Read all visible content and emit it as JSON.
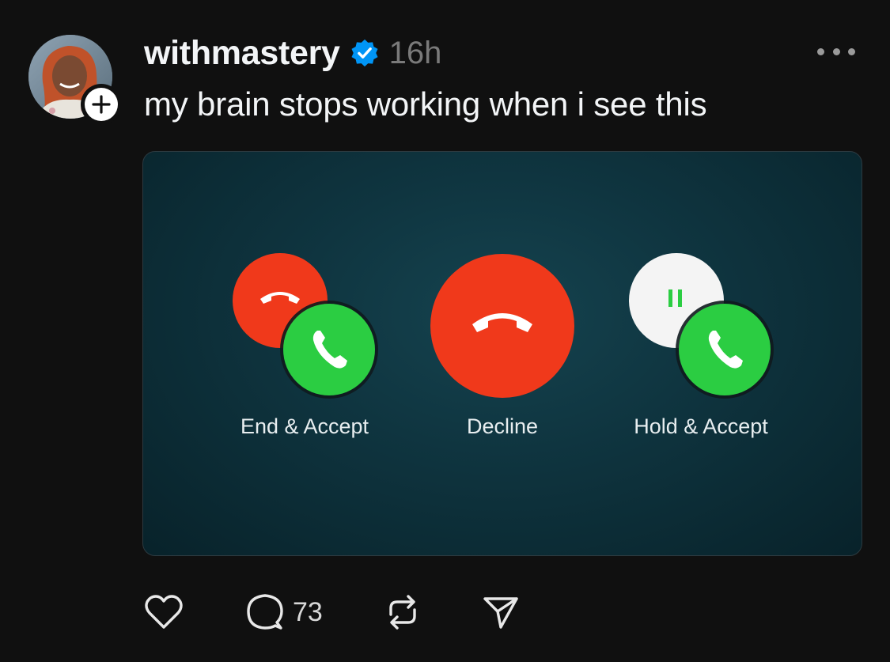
{
  "post": {
    "username": "withmastery",
    "timestamp": "16h",
    "text": "my brain stops working when i see this"
  },
  "media": {
    "labels": {
      "end_accept": "End & Accept",
      "decline": "Decline",
      "hold_accept": "Hold & Accept"
    }
  },
  "actions": {
    "reply_count": "73"
  },
  "colors": {
    "verified": "#0095f6",
    "decline_red": "#f0391b",
    "accept_green": "#2bcd42"
  },
  "icons": {
    "like": "heart-icon",
    "reply": "comment-icon",
    "repost": "repost-icon",
    "share": "send-icon",
    "more": "more-icon",
    "verified": "verified-badge-icon",
    "follow": "plus-icon"
  }
}
